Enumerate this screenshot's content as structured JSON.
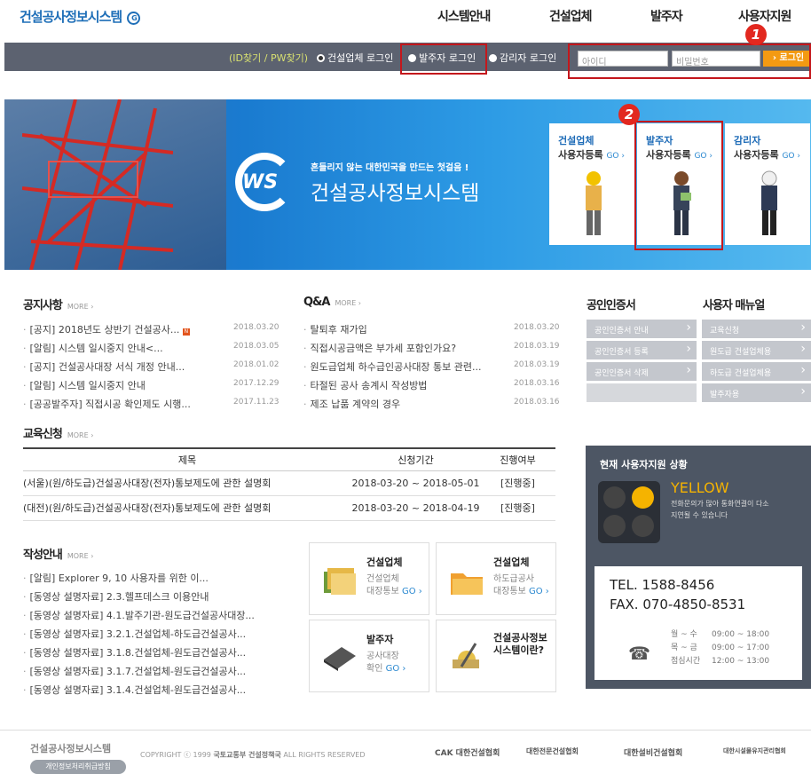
{
  "logo": {
    "text": "건설공사정보시스템",
    "mark": "G"
  },
  "gnb": [
    "시스템안내",
    "건설업체",
    "발주자",
    "사용자지원"
  ],
  "login": {
    "find": "(ID찾기 / PW찾기)",
    "radios": [
      "건설업체 로그인",
      "발주자 로그인",
      "감리자 로그인"
    ],
    "id_placeholder": "아이디",
    "pw_placeholder": "비밀번호",
    "button": "› 로그인"
  },
  "badges": [
    "1",
    "2"
  ],
  "hero": {
    "slogan": "흔들리지 않는 대한민국을 만드는 첫걸음 !",
    "ws": "WS",
    "title": "건설공사정보시스템",
    "cards": [
      {
        "title": "건설업체",
        "reg": "사용자등록",
        "go": "GO ›"
      },
      {
        "title": "발주자",
        "reg": "사용자등록",
        "go": "GO ›"
      },
      {
        "title": "감리자",
        "reg": "사용자등록",
        "go": "GO ›"
      }
    ]
  },
  "notice": {
    "title": "공지사항",
    "more": "MORE ›",
    "items": [
      {
        "t": "[공지] 2018년도 상반기 건설공사...",
        "new": "N",
        "d": "2018.03.20"
      },
      {
        "t": "[알림] 시스템 일시중지 안내<...",
        "d": "2018.03.05"
      },
      {
        "t": "[공지] 건설공사대장 서식 개정 안내...",
        "d": "2018.01.02"
      },
      {
        "t": "[알림] 시스템 일시중지 안내",
        "d": "2017.12.29"
      },
      {
        "t": "[공공발주자] 직접시공 확인제도 시행...",
        "d": "2017.11.23"
      }
    ]
  },
  "qna": {
    "title": "Q&A",
    "more": "MORE ›",
    "items": [
      {
        "t": "탈퇴후 재가입",
        "d": "2018.03.20"
      },
      {
        "t": "직접시공금액은 부가세 포함인가요?",
        "d": "2018.03.19"
      },
      {
        "t": "원도급업체 하수급인공사대장 통보 관련...",
        "d": "2018.03.19"
      },
      {
        "t": "타절된 공사 송계시 작성방법",
        "d": "2018.03.16"
      },
      {
        "t": "제조 납품 계약의 경우",
        "d": "2018.03.16"
      }
    ]
  },
  "cert": {
    "title": "공인인증서",
    "items": [
      "공인인증서 안내",
      "공인인증서 등록",
      "공인인증서 삭제"
    ]
  },
  "manual": {
    "title": "사용자 매뉴얼",
    "items": [
      "교육신청",
      "원도급 건설업체용",
      "하도급 건설업체용",
      "발주자용"
    ]
  },
  "edu": {
    "title": "교육신청",
    "more": "MORE ›",
    "headers": [
      "제목",
      "신청기간",
      "진행여부"
    ],
    "rows": [
      [
        "(서울)(원/하도급)건설공사대장(전자)통보제도에 관한 설명회",
        "2018-03-20 ~ 2018-05-01",
        "[진행중]"
      ],
      [
        "(대전)(원/하도급)건설공사대장(전자)통보제도에 관한 설명회",
        "2018-03-20 ~ 2018-04-19",
        "[진행중]"
      ]
    ]
  },
  "guide": {
    "title": "작성안내",
    "more": "MORE ›",
    "items": [
      "[알림] Explorer 9, 10 사용자를 위한 이...",
      "[동영상 설명자료] 2.3.헬프데스크 이용안내",
      "[동영상 설명자료] 4.1.발주기관-원도급건설공사대장...",
      "[동영상 설명자료] 3.2.1.건설업체-하도급건설공사...",
      "[동영상 설명자료] 3.1.8.건설업체-원도급건설공사...",
      "[동영상 설명자료] 3.1.7.건설업체-원도급건설공사...",
      "[동영상 설명자료] 3.1.4.건설업체-원도급건설공사..."
    ]
  },
  "tiles": [
    {
      "h": "건설업체",
      "b1": "건설업체",
      "b2": "대장통보",
      "go": "GO ›"
    },
    {
      "h": "건설업체",
      "b1": "하도급공사",
      "b2": "대장통보",
      "go": "GO ›"
    },
    {
      "h": "발주자",
      "b1": "공사대장",
      "b2": "확인",
      "go": "GO ›"
    },
    {
      "h": "건설공사정보",
      "h2": "시스템이란?"
    }
  ],
  "support": {
    "title": "현재 사용자지원 상황",
    "state": "YELLOW",
    "desc1": "전화문의가 많아 통화연결이 다소",
    "desc2": "지연될 수 있습니다",
    "tel": "TEL. 1588-8456",
    "fax": "FAX. 070-4850-8531",
    "hours": [
      [
        "월 ~ 수",
        "09:00 ~ 18:00"
      ],
      [
        "목 ~ 금",
        "09:00 ~ 17:00"
      ],
      [
        "점심시간",
        "12:00 ~ 13:00"
      ]
    ]
  },
  "footer": {
    "logo": "건설공사정보시스템",
    "privacy": "개인정보처리취급방침",
    "copy": "COPYRIGHT ⓒ 1999",
    "org": "국토교통부 건설정책국",
    "rights": "ALL RIGHTS RESERVED",
    "partners": [
      "CAK 대한건설협회",
      "대한전문건설협회",
      "대한설비건설협회",
      "대한시설물유지관리협회"
    ]
  }
}
